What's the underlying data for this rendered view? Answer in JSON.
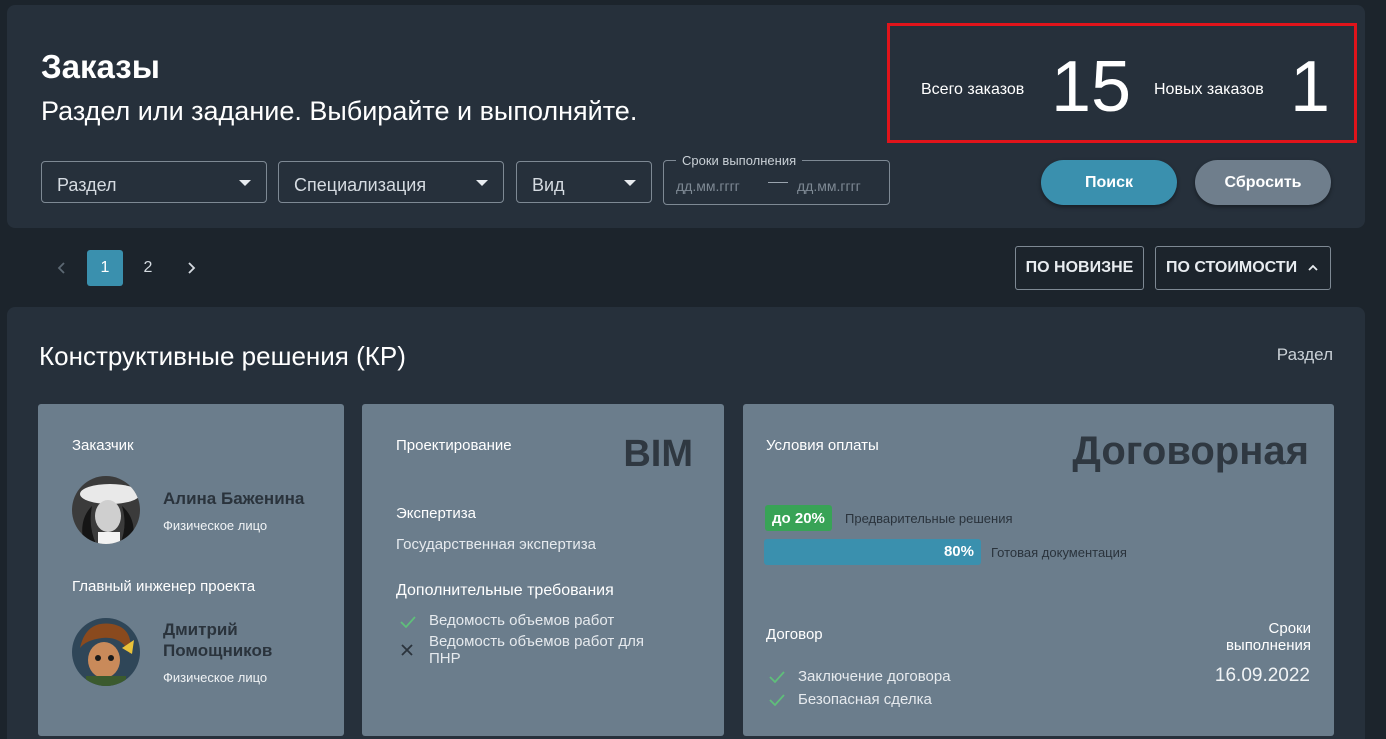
{
  "header": {
    "title": "Заказы",
    "subtitle": "Раздел или задание. Выбирайте и выполняйте.",
    "stats": {
      "total_label": "Всего заказов",
      "total_value": "15",
      "new_label": "Новых заказов",
      "new_value": "1"
    },
    "filters": {
      "section": "Раздел",
      "specialization": "Специализация",
      "kind": "Вид",
      "deadline_legend": "Сроки выполнения",
      "date_from_placeholder": "дд.мм.гггг",
      "date_to_placeholder": "дд.мм.гггг"
    },
    "search_button": "Поиск",
    "reset_button": "Сбросить"
  },
  "pagination": {
    "pages": [
      "1",
      "2"
    ],
    "active_page": "1"
  },
  "sort": {
    "by_newest": "ПО НОВИЗНЕ",
    "by_price": "ПО СТОИМОСТИ"
  },
  "order": {
    "title": "Конструктивные решения (КР)",
    "type_label": "Раздел",
    "customer": {
      "label": "Заказчик",
      "name": "Алина Баженина",
      "role": "Физическое лицо"
    },
    "chief_engineer": {
      "label": "Главный инженер проекта",
      "name_line1": "Дмитрий",
      "name_line2": "Помощников",
      "role": "Физическое лицо"
    },
    "design": {
      "label": "Проектирование",
      "value": "BIM",
      "expertise_label": "Экспертиза",
      "expertise_value": "Государственная экспертиза",
      "requirements_label": "Дополнительные требования",
      "requirements": [
        {
          "text": "Ведомость объемов работ",
          "status": "check"
        },
        {
          "text_line1": "Ведомость объемов работ для",
          "text_line2": "ПНР",
          "status": "cross"
        }
      ]
    },
    "payment": {
      "label": "Условия оплаты",
      "value": "Договорная",
      "prepay_badge": "до 20%",
      "prepay_note": "Предварительные решения",
      "progress_percent": 80,
      "progress_label": "80%",
      "progress_note": "Готовая документация",
      "contract_label": "Договор",
      "contract_items": [
        "Заключение договора",
        "Безопасная сделка"
      ],
      "deadline_label_line1": "Сроки",
      "deadline_label_line2": "выполнения",
      "deadline_value": "16.09.2022"
    }
  },
  "colors": {
    "accent": "#3a90ae",
    "success": "#38a356",
    "highlight_border": "#e0141b",
    "card_bg": "#6b7d8c"
  }
}
